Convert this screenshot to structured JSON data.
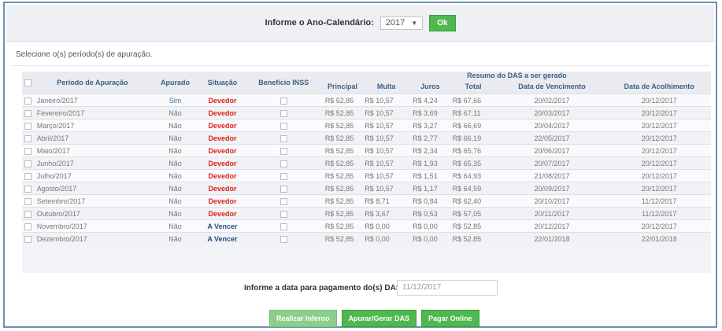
{
  "header": {
    "year_label": "Informe o Ano-Calendário:",
    "year_value": "2017",
    "ok_label": "Ok"
  },
  "subtitle": "Selecione o(s) período(s) de apuração.",
  "table": {
    "group_header": "Resumo do DAS a ser gerado",
    "columns": [
      "Período de Apuração",
      "Apurado",
      "Situação",
      "Benefício INSS",
      "Principal",
      "Multa",
      "Juros",
      "Total",
      "Data de Vencimento",
      "Data de Acolhimento"
    ],
    "rows": [
      {
        "periodo": "Janeiro/2017",
        "apurado": "Sim",
        "situacao": "Devedor",
        "principal": "R$ 52,85",
        "multa": "R$ 10,57",
        "juros": "R$ 4,24",
        "total": "R$ 67,66",
        "vencimento": "20/02/2017",
        "acolhimento": "20/12/2017"
      },
      {
        "periodo": "Fevereiro/2017",
        "apurado": "Não",
        "situacao": "Devedor",
        "principal": "R$ 52,85",
        "multa": "R$ 10,57",
        "juros": "R$ 3,69",
        "total": "R$ 67,11",
        "vencimento": "20/03/2017",
        "acolhimento": "20/12/2017"
      },
      {
        "periodo": "Março/2017",
        "apurado": "Não",
        "situacao": "Devedor",
        "principal": "R$ 52,85",
        "multa": "R$ 10,57",
        "juros": "R$ 3,27",
        "total": "R$ 66,69",
        "vencimento": "20/04/2017",
        "acolhimento": "20/12/2017"
      },
      {
        "periodo": "Abril/2017",
        "apurado": "Não",
        "situacao": "Devedor",
        "principal": "R$ 52,85",
        "multa": "R$ 10,57",
        "juros": "R$ 2,77",
        "total": "R$ 66,19",
        "vencimento": "22/05/2017",
        "acolhimento": "20/12/2017"
      },
      {
        "periodo": "Maio/2017",
        "apurado": "Não",
        "situacao": "Devedor",
        "principal": "R$ 52,85",
        "multa": "R$ 10,57",
        "juros": "R$ 2,34",
        "total": "R$ 65,76",
        "vencimento": "20/06/2017",
        "acolhimento": "20/12/2017"
      },
      {
        "periodo": "Junho/2017",
        "apurado": "Não",
        "situacao": "Devedor",
        "principal": "R$ 52,85",
        "multa": "R$ 10,57",
        "juros": "R$ 1,93",
        "total": "R$ 65,35",
        "vencimento": "20/07/2017",
        "acolhimento": "20/12/2017"
      },
      {
        "periodo": "Julho/2017",
        "apurado": "Não",
        "situacao": "Devedor",
        "principal": "R$ 52,85",
        "multa": "R$ 10,57",
        "juros": "R$ 1,51",
        "total": "R$ 64,93",
        "vencimento": "21/08/2017",
        "acolhimento": "20/12/2017"
      },
      {
        "periodo": "Agosto/2017",
        "apurado": "Não",
        "situacao": "Devedor",
        "principal": "R$ 52,85",
        "multa": "R$ 10,57",
        "juros": "R$ 1,17",
        "total": "R$ 64,59",
        "vencimento": "20/09/2017",
        "acolhimento": "20/12/2017"
      },
      {
        "periodo": "Setembro/2017",
        "apurado": "Não",
        "situacao": "Devedor",
        "principal": "R$ 52,85",
        "multa": "R$ 8,71",
        "juros": "R$ 0,84",
        "total": "R$ 62,40",
        "vencimento": "20/10/2017",
        "acolhimento": "11/12/2017"
      },
      {
        "periodo": "Outubro/2017",
        "apurado": "Não",
        "situacao": "Devedor",
        "principal": "R$ 52,85",
        "multa": "R$ 3,67",
        "juros": "R$ 0,53",
        "total": "R$ 57,05",
        "vencimento": "20/11/2017",
        "acolhimento": "11/12/2017"
      },
      {
        "periodo": "Novembro/2017",
        "apurado": "Não",
        "situacao": "A Vencer",
        "principal": "R$ 52,85",
        "multa": "R$ 0,00",
        "juros": "R$ 0,00",
        "total": "R$ 52,85",
        "vencimento": "20/12/2017",
        "acolhimento": "20/12/2017"
      },
      {
        "periodo": "Dezembro/2017",
        "apurado": "Não",
        "situacao": "A Vencer",
        "principal": "R$ 52,85",
        "multa": "R$ 0,00",
        "juros": "R$ 0,00",
        "total": "R$ 52,85",
        "vencimento": "22/01/2018",
        "acolhimento": "22/01/2018"
      }
    ]
  },
  "payment": {
    "label": "Informe a data para pagamento do(s) DAS:",
    "date_value": "11/12/2017"
  },
  "buttons": {
    "realizar": "Realizar Inferno",
    "apurar": "Apurar/Gerar DAS",
    "pagar": "Pagar Online"
  },
  "colors": {
    "accent_green": "#4fb84f",
    "devedor_red": "#e0201b",
    "a_vencer_blue": "#2c4f86"
  }
}
